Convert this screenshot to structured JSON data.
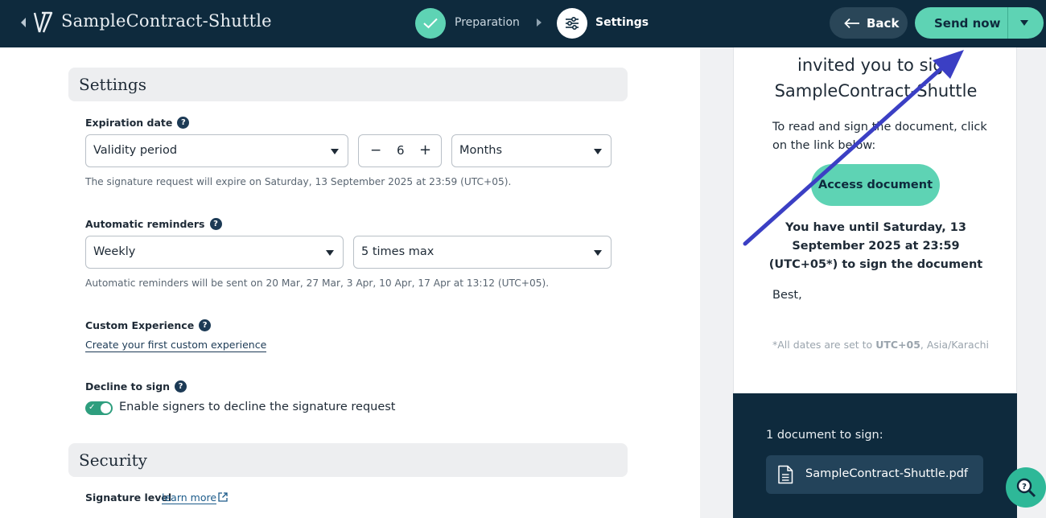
{
  "header": {
    "title": "SampleContract-Shuttle",
    "steps": [
      {
        "label": "Preparation",
        "state": "done"
      },
      {
        "label": "Settings",
        "state": "active"
      }
    ],
    "back_label": "Back",
    "send_label": "Send now"
  },
  "settings": {
    "section_title": "Settings",
    "expiration": {
      "label": "Expiration date",
      "mode": "Validity period",
      "amount": "6",
      "unit": "Months",
      "hint": "The signature request will expire on Saturday, 13 September 2025 at 23:59 (UTC+05)."
    },
    "reminders": {
      "label": "Automatic reminders",
      "frequency": "Weekly",
      "max": "5 times max",
      "hint": "Automatic reminders will be sent on 20 Mar, 27 Mar, 3 Apr, 10 Apr, 17 Apr at 13:12 (UTC+05)."
    },
    "custom_experience": {
      "label": "Custom Experience",
      "link": "Create your first custom experience"
    },
    "decline": {
      "label": "Decline to sign",
      "toggle_label": "Enable signers to decline the signature request",
      "enabled": true
    }
  },
  "security": {
    "section_title": "Security",
    "signature_level_label": "Signature level",
    "learn_more": "learn more"
  },
  "preview": {
    "heading_line1": "invited you to sign",
    "heading_line2": "SampleContract-Shuttle",
    "body": "To read and sign the document, click on the link below:",
    "access_button": "Access document",
    "deadline": "You have until Saturday, 13 September 2025 at 23:59 (UTC+05*) to sign the document",
    "sign_off": "Best,",
    "tz_prefix": "*All dates are set to ",
    "tz_bold": "UTC+05",
    "tz_suffix": ", Asia/Karachi",
    "docs_count": "1 document to sign:",
    "doc_name": "SampleContract-Shuttle.pdf"
  },
  "icons": {
    "help": "?",
    "toggle_check": "✓",
    "minus": "−",
    "plus": "+"
  },
  "colors": {
    "navy": "#0e2a3d",
    "mint": "#5ed3b4",
    "annotation_arrow": "#3b3fc4"
  }
}
